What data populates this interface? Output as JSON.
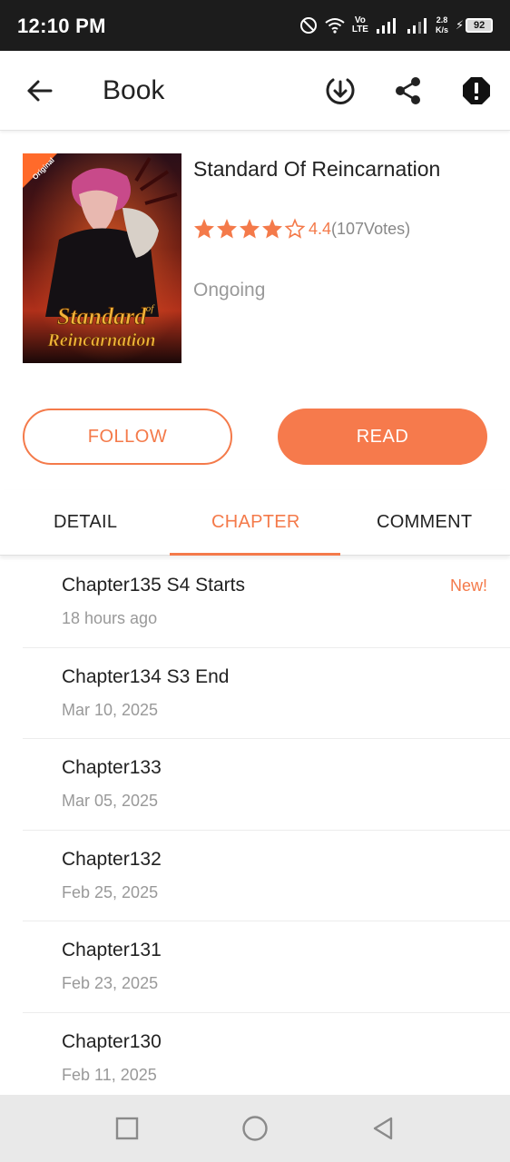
{
  "status_bar": {
    "time": "12:10 PM",
    "network_type_top": "Vo",
    "network_type_bottom": "LTE",
    "speed_value": "2.8",
    "speed_unit": "K/s",
    "battery": "92",
    "icons": [
      "do-not-disturb-icon",
      "wifi-icon",
      "signal-icon",
      "signal-icon",
      "charging-icon",
      "battery-icon"
    ]
  },
  "app_bar": {
    "title": "Book",
    "icons": [
      "back-arrow-icon",
      "download-icon",
      "share-icon",
      "report-icon"
    ]
  },
  "book": {
    "title": "Standard Of Reincarnation",
    "rating": "4.4",
    "rating_stars": 4,
    "votes": "(107Votes)",
    "status": "Ongoing",
    "cover_text_line1": "Standard",
    "cover_text_of": "of",
    "cover_text_line2": "Reincarnation",
    "cover_badge": "Original"
  },
  "actions": {
    "follow_label": "FOLLOW",
    "read_label": "READ"
  },
  "tabs": [
    {
      "label": "DETAIL",
      "active": false
    },
    {
      "label": "CHAPTER",
      "active": true
    },
    {
      "label": "COMMENT",
      "active": false
    }
  ],
  "chapters": [
    {
      "name": "Chapter135 S4 Starts",
      "date": "18 hours ago",
      "badge": "New!"
    },
    {
      "name": "Chapter134 S3 End",
      "date": "Mar 10, 2025",
      "badge": ""
    },
    {
      "name": "Chapter133",
      "date": "Mar 05, 2025",
      "badge": ""
    },
    {
      "name": "Chapter132",
      "date": "Feb 25, 2025",
      "badge": ""
    },
    {
      "name": "Chapter131",
      "date": "Feb 23, 2025",
      "badge": ""
    },
    {
      "name": "Chapter130",
      "date": "Feb 11, 2025",
      "badge": ""
    }
  ],
  "nav_bar": {
    "icons": [
      "recents-square-icon",
      "home-circle-icon",
      "back-triangle-icon"
    ]
  },
  "colors": {
    "accent": "#f47a4a",
    "read_button": "#f67a4c",
    "status_bar_bg": "#1c1c1c",
    "nav_bar_bg": "#e9e9e9"
  }
}
